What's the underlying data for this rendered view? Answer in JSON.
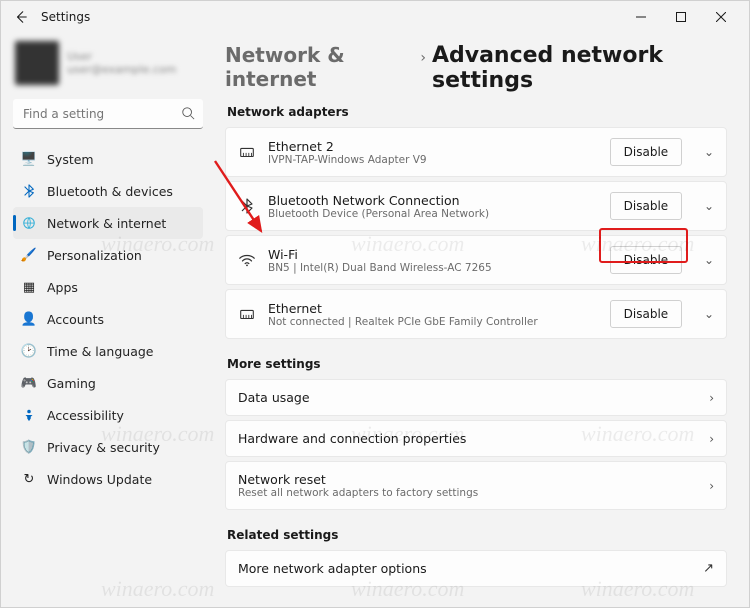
{
  "title": "Settings",
  "account": {
    "name_line1": "User",
    "name_line2": "user@example.com"
  },
  "search": {
    "placeholder": "Find a setting"
  },
  "nav": [
    {
      "id": "system",
      "label": "System",
      "icon": "🖥️"
    },
    {
      "id": "bluetooth",
      "label": "Bluetooth & devices",
      "icon": "bt"
    },
    {
      "id": "network",
      "label": "Network & internet",
      "icon": "net",
      "active": true
    },
    {
      "id": "personalization",
      "label": "Personalization",
      "icon": "🖌️"
    },
    {
      "id": "apps",
      "label": "Apps",
      "icon": "▦"
    },
    {
      "id": "accounts",
      "label": "Accounts",
      "icon": "👤"
    },
    {
      "id": "time",
      "label": "Time & language",
      "icon": "🕑"
    },
    {
      "id": "gaming",
      "label": "Gaming",
      "icon": "🎮"
    },
    {
      "id": "accessibility",
      "label": "Accessibility",
      "icon": "acc"
    },
    {
      "id": "privacy",
      "label": "Privacy & security",
      "icon": "🛡️"
    },
    {
      "id": "update",
      "label": "Windows Update",
      "icon": "↻"
    }
  ],
  "breadcrumb": {
    "root": "Network & internet",
    "leaf": "Advanced network settings"
  },
  "sections": {
    "adapters_header": "Network adapters",
    "more_header": "More settings",
    "related_header": "Related settings"
  },
  "adapters": [
    {
      "title": "Ethernet 2",
      "sub": "IVPN-TAP-Windows Adapter V9",
      "btn": "Disable",
      "icon": "eth"
    },
    {
      "title": "Bluetooth Network Connection",
      "sub": "Bluetooth Device (Personal Area Network)",
      "btn": "Disable",
      "icon": "bt"
    },
    {
      "title": "Wi-Fi",
      "sub": "BN5 | Intel(R) Dual Band Wireless-AC 7265",
      "btn": "Disable",
      "icon": "wifi"
    },
    {
      "title": "Ethernet",
      "sub": "Not connected | Realtek PCIe GbE Family Controller",
      "btn": "Disable",
      "icon": "eth"
    }
  ],
  "more": [
    {
      "title": "Data usage",
      "sub": "",
      "kind": "arrow"
    },
    {
      "title": "Hardware and connection properties",
      "sub": "",
      "kind": "arrow"
    },
    {
      "title": "Network reset",
      "sub": "Reset all network adapters to factory settings",
      "kind": "arrow"
    }
  ],
  "related": [
    {
      "title": "More network adapter options",
      "kind": "ext"
    }
  ],
  "watermark": "winaero.com"
}
